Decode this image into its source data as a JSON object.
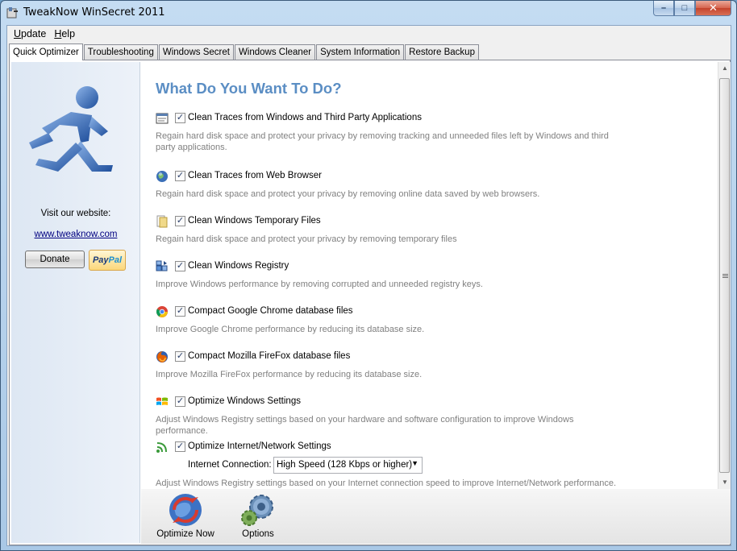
{
  "window": {
    "title": "TweakNow WinSecret 2011",
    "controls": {
      "minimize": "–",
      "maximize": "□",
      "close": "✕"
    }
  },
  "menu": [
    {
      "label": "Update",
      "mnemonic": "U",
      "rest": "pdate"
    },
    {
      "label": "Help",
      "mnemonic": "H",
      "rest": "elp"
    }
  ],
  "tabs": [
    {
      "label": "Quick Optimizer",
      "active": true
    },
    {
      "label": "Troubleshooting",
      "active": false
    },
    {
      "label": "Windows Secret",
      "active": false
    },
    {
      "label": "Windows Cleaner",
      "active": false
    },
    {
      "label": "System Information",
      "active": false
    },
    {
      "label": "Restore Backup",
      "active": false
    }
  ],
  "sidebar": {
    "visit_label": "Visit our website:",
    "website": "www.tweaknow.com",
    "donate_label": "Donate",
    "paypal": {
      "pay": "Pay",
      "pal": "Pal"
    }
  },
  "main": {
    "heading": "What Do You Want To Do?",
    "options": [
      {
        "icon": "window-icon",
        "checked": true,
        "label": "Clean Traces from Windows and Third Party Applications",
        "desc": "Regain hard disk space and protect your privacy by removing tracking and unneeded files left by Windows and third party applications."
      },
      {
        "icon": "globe-icon",
        "checked": true,
        "label": "Clean Traces from Web Browser",
        "desc": "Regain hard disk space and protect your privacy by removing online data saved by web browsers."
      },
      {
        "icon": "folder-icon",
        "checked": true,
        "label": "Clean Windows Temporary Files",
        "desc": "Regain hard disk space and protect your privacy by removing temporary files"
      },
      {
        "icon": "registry-icon",
        "checked": true,
        "label": "Clean Windows Registry",
        "desc": "Improve Windows performance by removing corrupted and unneeded registry keys."
      },
      {
        "icon": "chrome-icon",
        "checked": true,
        "label": "Compact Google Chrome database files",
        "desc": "Improve Google Chrome performance by reducing its database size."
      },
      {
        "icon": "firefox-icon",
        "checked": true,
        "label": "Compact Mozilla FireFox database files",
        "desc": "Improve Mozilla FireFox performance by reducing its database size."
      },
      {
        "icon": "windows-logo-icon",
        "checked": true,
        "label": "Optimize Windows Settings",
        "desc": "Adjust Windows Registry settings based on your hardware and software configuration to improve Windows performance."
      },
      {
        "icon": "network-icon",
        "checked": true,
        "label": "Optimize Internet/Network Settings",
        "desc": "Adjust Windows Registry settings based on your Internet connection speed to improve Internet/Network performance."
      }
    ],
    "connection": {
      "label": "Internet Connection:",
      "selected": "High Speed (128 Kbps or higher)"
    },
    "check_mark": "✓"
  },
  "toolbar": {
    "optimize_label": "Optimize Now",
    "options_label": "Options"
  },
  "colors": {
    "heading": "#5b8ec4",
    "description": "#808080",
    "link": "#000080"
  }
}
